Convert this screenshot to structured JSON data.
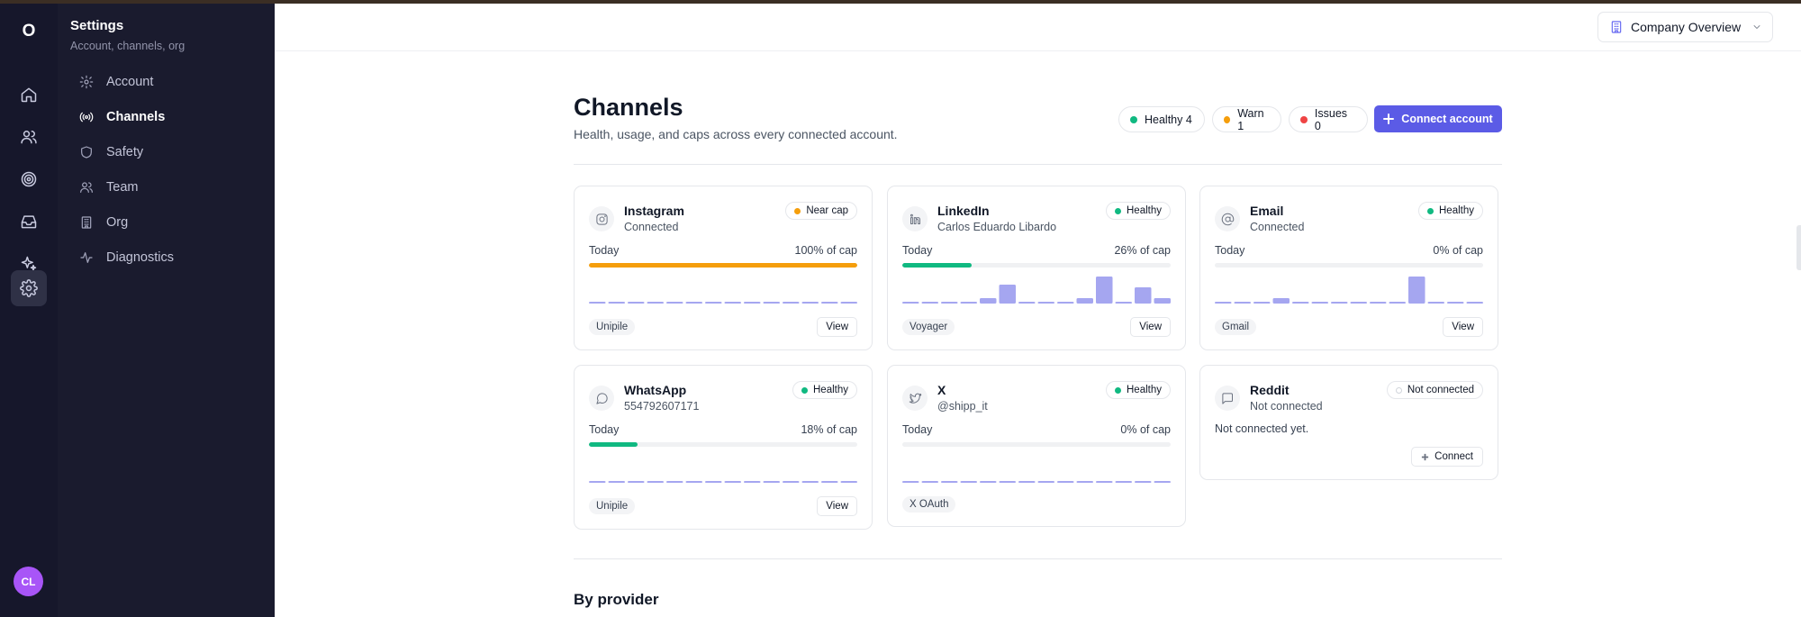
{
  "rail": {
    "logo": "O",
    "avatar": "CL"
  },
  "sidebar": {
    "title": "Settings",
    "subtitle": "Account, channels, org",
    "items": [
      {
        "label": "Account",
        "icon": "gear-icon"
      },
      {
        "label": "Channels",
        "icon": "broadcast-icon"
      },
      {
        "label": "Safety",
        "icon": "shield-icon"
      },
      {
        "label": "Team",
        "icon": "users-icon"
      },
      {
        "label": "Org",
        "icon": "building-icon"
      },
      {
        "label": "Diagnostics",
        "icon": "activity-icon"
      }
    ]
  },
  "header": {
    "org_label": "Company Overview"
  },
  "page": {
    "title": "Channels",
    "subtitle": "Health, usage, and caps across every connected account.",
    "status": {
      "healthy": "Healthy 4",
      "warn": "Warn 1",
      "issues": "Issues 0"
    },
    "connect_label": "Connect account",
    "section_title": "By provider"
  },
  "colors": {
    "accent": "#5b5be6",
    "healthy": "#10b981",
    "warn": "#f59e0b",
    "issues": "#ef4444",
    "spark": "#a5a6f0"
  },
  "channels": [
    {
      "name": "Instagram",
      "account": "Connected",
      "status": "Near cap",
      "status_color": "#f59e0b",
      "today_label": "Today",
      "cap_label": "100% of cap",
      "usage_pct": 100,
      "bar_color": "#f59e0b",
      "provider": "Unipile",
      "view_label": "View",
      "spark": [
        0,
        0,
        0,
        0,
        0,
        0,
        0,
        0,
        0,
        0,
        0,
        0,
        0,
        0
      ]
    },
    {
      "name": "LinkedIn",
      "account": "Carlos Eduardo Libardo",
      "status": "Healthy",
      "status_color": "#10b981",
      "today_label": "Today",
      "cap_label": "26% of cap",
      "usage_pct": 26,
      "bar_color": "#10b981",
      "provider": "Voyager",
      "view_label": "View",
      "spark": [
        0,
        0,
        0,
        0,
        2,
        7,
        0,
        0,
        0,
        2,
        10,
        0,
        6,
        2
      ]
    },
    {
      "name": "Email",
      "account": "Connected",
      "status": "Healthy",
      "status_color": "#10b981",
      "today_label": "Today",
      "cap_label": "0% of cap",
      "usage_pct": 0,
      "bar_color": "#10b981",
      "provider": "Gmail",
      "view_label": "View",
      "spark": [
        0,
        0,
        0,
        2,
        0,
        0,
        0,
        0,
        0,
        0,
        10,
        0,
        0,
        0
      ]
    },
    {
      "name": "WhatsApp",
      "account": "554792607171",
      "status": "Healthy",
      "status_color": "#10b981",
      "today_label": "Today",
      "cap_label": "18% of cap",
      "usage_pct": 18,
      "bar_color": "#10b981",
      "provider": "Unipile",
      "view_label": "View",
      "spark": [
        0,
        0,
        0,
        0,
        0,
        0,
        0,
        0,
        0,
        0,
        0,
        0,
        0,
        0
      ]
    },
    {
      "name": "X",
      "account": "@shipp_it",
      "status": "Healthy",
      "status_color": "#10b981",
      "today_label": "Today",
      "cap_label": "0% of cap",
      "usage_pct": 0,
      "bar_color": "#10b981",
      "provider": "X OAuth",
      "spark": [
        0,
        0,
        0,
        0,
        0,
        0,
        0,
        0,
        0,
        0,
        0,
        0,
        0,
        0
      ]
    },
    {
      "name": "Reddit",
      "account": "Not connected",
      "status": "Not connected",
      "message": "Not connected yet.",
      "connect_label": "Connect"
    }
  ]
}
